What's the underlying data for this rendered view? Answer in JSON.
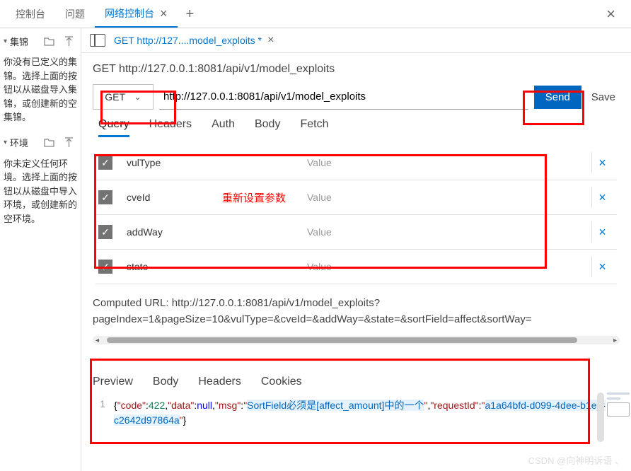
{
  "top_tabs": {
    "items": [
      "控制台",
      "问题",
      "网络控制台"
    ],
    "active_index": 2
  },
  "sidebar": {
    "jijin": {
      "title": "集锦",
      "desc": "你没有已定义的集锦。选择上面的按钮以从磁盘导入集锦，或创建新的空集锦。"
    },
    "huanjing": {
      "title": "环境",
      "desc": "你未定义任何环境。选择上面的按钮以从磁盘中导入环境，或创建新的空环境。"
    }
  },
  "inner_tab": {
    "label": "GET http://127....model_exploits *"
  },
  "request": {
    "title": "GET http://127.0.0.1:8081/api/v1/model_exploits",
    "method": "GET",
    "url": "http://127.0.0.1:8081/api/v1/model_exploits",
    "send_label": "Send",
    "save_label": "Save"
  },
  "sub_tabs": {
    "items": [
      "Query",
      "Headers",
      "Auth",
      "Body",
      "Fetch"
    ],
    "active_index": 0
  },
  "params": {
    "value_placeholder": "Value",
    "annotation": "重新设置参数",
    "rows": [
      {
        "key": "vulType",
        "checked": true
      },
      {
        "key": "cveId",
        "checked": true
      },
      {
        "key": "addWay",
        "checked": true
      },
      {
        "key": "state",
        "checked": true
      }
    ]
  },
  "computed_url_label": "Computed URL: ",
  "computed_url_value": "http://127.0.0.1:8081/api/v1/model_exploits?pageIndex=1&pageSize=10&vulType=&cveId=&addWay=&state=&sortField=affect&sortWay=",
  "resp_tabs": {
    "items": [
      "Preview",
      "Body",
      "Headers",
      "Cookies"
    ]
  },
  "response": {
    "line": "1",
    "json_parts": {
      "code_k": "\"code\"",
      "code_v": "422",
      "data_k": "\"data\"",
      "data_v": "null",
      "msg_k": "\"msg\"",
      "msg_v1": "\"",
      "msg_link1": "SortField必须是[affect_amount]中的一个",
      "msg_v2": "\"",
      "rid_k": "\"requestId\"",
      "rid_v1": "\"",
      "rid_link": "a1a64bfd-d099-4dee-b1e9-c2642d97864a",
      "rid_v2": "\""
    }
  },
  "watermark": "CSDN @向神明诉语 、"
}
